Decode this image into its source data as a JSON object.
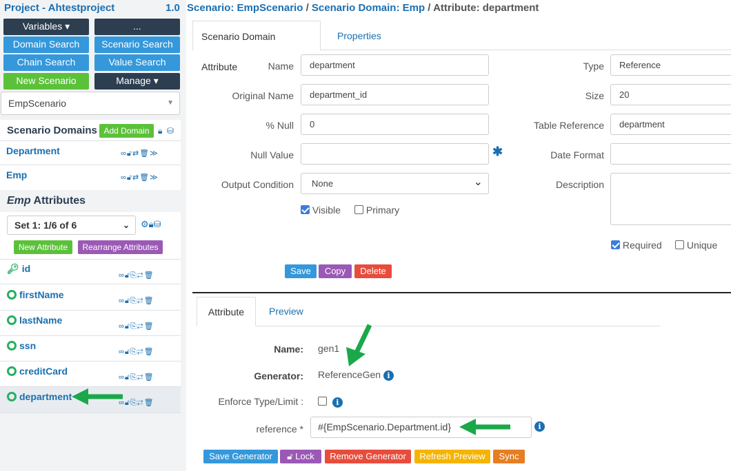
{
  "sidebar": {
    "project_title": "Project - Ahtestproject",
    "version": "1.0",
    "buttons": {
      "variables": "Variables ▾",
      "more": "...",
      "domain_search": "Domain Search",
      "scenario_search": "Scenario Search",
      "chain_search": "Chain Search",
      "value_search": "Value Search",
      "new_scenario": "New Scenario",
      "manage": "Manage ▾"
    },
    "scenario_select": "EmpScenario",
    "scenario_domains_title": "Scenario Domains",
    "add_domain": "Add Domain",
    "domains": [
      {
        "label": "Department"
      },
      {
        "label": "Emp"
      }
    ],
    "attributes_title_em": "Emp",
    "attributes_title_rest": " Attributes",
    "set_select": "Set 1: 1/6 of 6",
    "new_attribute": "New Attribute",
    "rearrange_attributes": "Rearrange Attributes",
    "attributes": [
      {
        "label": "id",
        "icon": "key-icon"
      },
      {
        "label": "firstName",
        "icon": "lifebuoy-icon"
      },
      {
        "label": "lastName",
        "icon": "lifebuoy-icon"
      },
      {
        "label": "ssn",
        "icon": "lifebuoy-icon"
      },
      {
        "label": "creditCard",
        "icon": "lifebuoy-icon"
      },
      {
        "label": "department",
        "icon": "lifebuoy-icon"
      }
    ]
  },
  "breadcrumb": {
    "scenario": "Scenario: EmpScenario",
    "sep1": " / ",
    "domain": "Scenario Domain: Emp",
    "sep2": " / ",
    "attribute": "Attribute: department"
  },
  "tabs": {
    "scenario_domain_attribute": "Scenario Domain Attribute",
    "properties": "Properties"
  },
  "form": {
    "name_label": "Name",
    "name_value": "department",
    "original_name_label": "Original Name",
    "original_name_value": "department_id",
    "null_pct_label": "% Null",
    "null_pct_value": "0",
    "null_value_label": "Null Value",
    "null_value_value": "",
    "output_condition_label": "Output Condition",
    "output_condition_value": "None",
    "visible_label": "Visible",
    "primary_label": "Primary",
    "type_label": "Type",
    "type_value": "Reference",
    "size_label": "Size",
    "size_value": "20",
    "table_reference_label": "Table Reference",
    "table_reference_value": "department",
    "date_format_label": "Date Format",
    "date_format_value": "",
    "description_label": "Description",
    "required_label": "Required",
    "unique_label": "Unique",
    "save": "Save",
    "copy": "Copy",
    "delete": "Delete"
  },
  "lower_tabs": {
    "attribute": "Attribute",
    "preview": "Preview"
  },
  "generator": {
    "name_label": "Name:",
    "name_value": "gen1",
    "generator_label": "Generator:",
    "generator_value": "ReferenceGen",
    "enforce_label": "Enforce Type/Limit :",
    "reference_label": "reference *",
    "reference_value": "#{EmpScenario.Department.id}",
    "save_generator": "Save Generator",
    "lock": "Lock",
    "remove_generator": "Remove Generator",
    "refresh_preview": "Refresh Preview",
    "sync": "Sync"
  },
  "colors": {
    "link": "#1a6fb0",
    "dark_button": "#2c3e50",
    "blue_button": "#3498db",
    "green_button": "#5cc13a",
    "purple_button": "#9b59b6",
    "red_button": "#e74c3c",
    "annotation_arrow": "#1aa84a"
  }
}
